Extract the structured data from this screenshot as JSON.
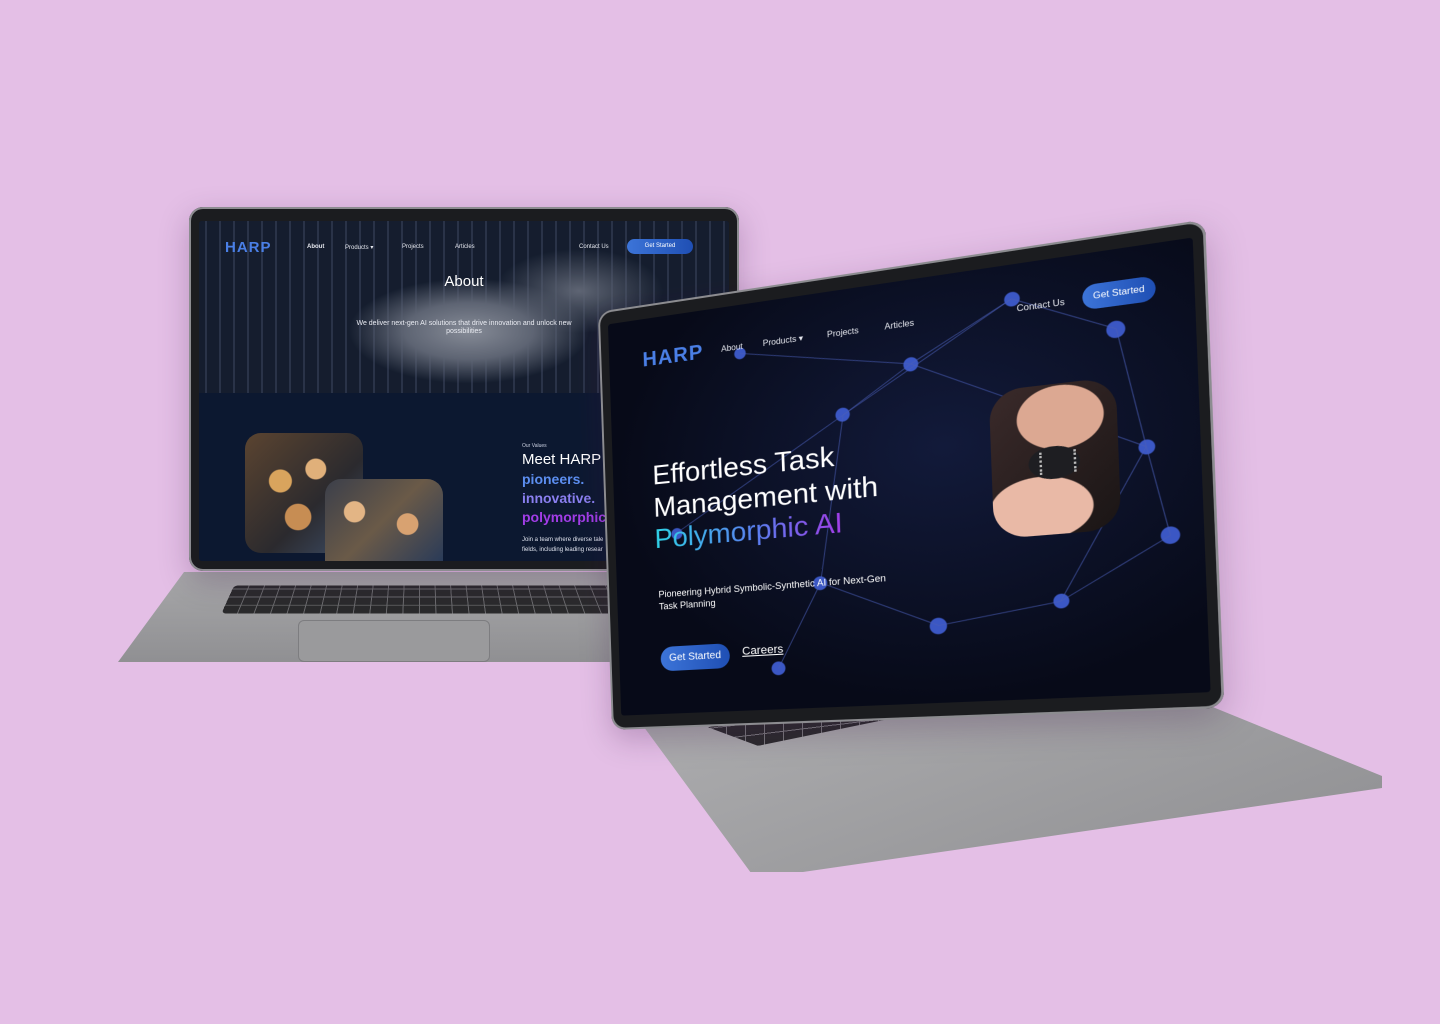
{
  "back_laptop": {
    "nav": {
      "logo": "HARP",
      "items": [
        "About",
        "Products",
        "Projects",
        "Articles"
      ],
      "contact": "Contact Us",
      "cta": "Get Started"
    },
    "hero": {
      "title": "About",
      "subtitle": "We deliver next-gen AI solutions that drive innovation and unlock new possibilities"
    },
    "values": {
      "label": "Our Values",
      "heading": "Meet HARP I",
      "word1": "pioneers.",
      "word2": "innovative.",
      "word3": "polymorphic",
      "body": "Join a team where diverse tale\nfields, including leading resear"
    }
  },
  "front_laptop": {
    "nav": {
      "logo": "HARP",
      "items": [
        "About",
        "Products",
        "Projects",
        "Articles"
      ],
      "contact": "Contact Us",
      "cta": "Get Started"
    },
    "hero": {
      "line1": "Effortless Task",
      "line2": "Management with",
      "line3": "Polymorphic AI",
      "subtitle": "Pioneering Hybrid Symbolic-Synthetic AI for Next-Gen Task Planning",
      "primary_button": "Get Started",
      "secondary_link": "Careers"
    }
  },
  "colors": {
    "background": "#e4bfe6",
    "accent": "#3c74d8",
    "gradient_start": "#2fd3e8",
    "gradient_end": "#a23de8"
  },
  "icons": [
    "chevron-down-icon"
  ]
}
